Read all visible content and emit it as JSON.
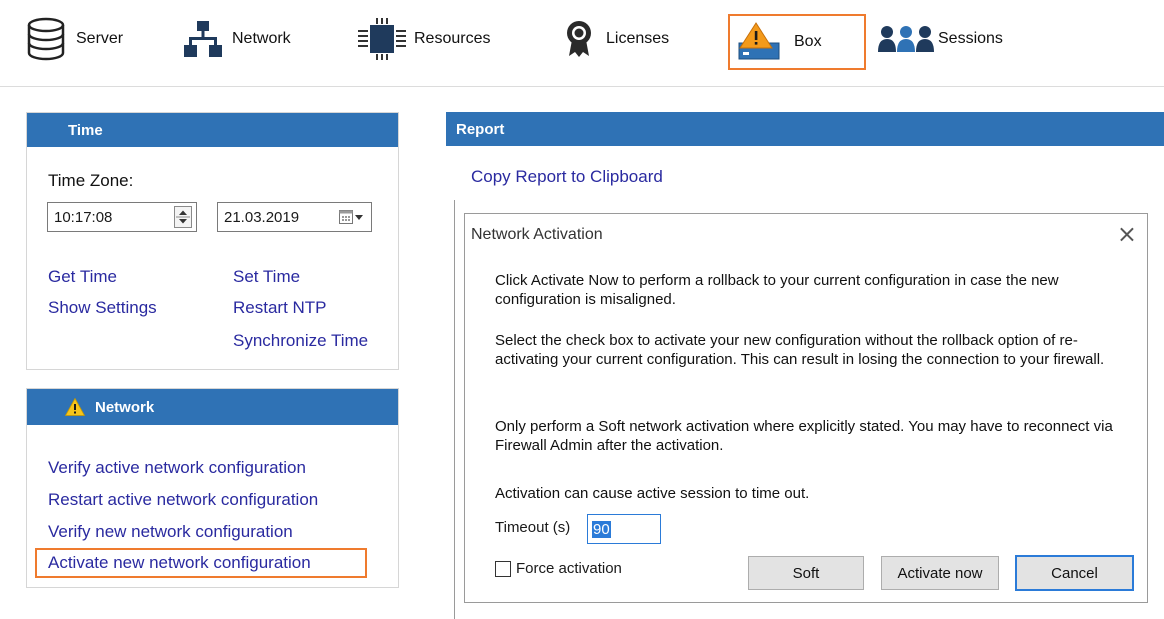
{
  "toolbar": {
    "items": [
      {
        "label": "Server",
        "icon": "database-icon"
      },
      {
        "label": "Network",
        "icon": "network-icon"
      },
      {
        "label": "Resources",
        "icon": "chip-icon"
      },
      {
        "label": "Licenses",
        "icon": "license-badge-icon"
      },
      {
        "label": "Box",
        "icon": "box-warning-icon"
      },
      {
        "label": "Sessions",
        "icon": "users-icon"
      }
    ],
    "active_item": "Box",
    "active_color": "#ef7b2e"
  },
  "time_panel": {
    "title": "Time",
    "timezone_label": "Time Zone:",
    "time_value": "10:17:08",
    "date_value": "21.03.2019",
    "links": {
      "get_time": "Get Time",
      "set_time": "Set Time",
      "show_settings": "Show Settings",
      "restart_ntp": "Restart NTP",
      "synchronize_time": "Synchronize Time"
    }
  },
  "network_panel": {
    "title": "Network",
    "links": [
      "Verify active network configuration",
      "Restart active network configuration",
      "Verify new network configuration",
      "Activate new network configuration"
    ],
    "highlight_color": "#ef7b2e"
  },
  "report_panel": {
    "title": "Report",
    "copy_link": "Copy Report to Clipboard"
  },
  "dialog": {
    "title": "Network Activation",
    "paragraph1": "Click Activate Now to perform a rollback to your current configuration in case the new configuration is misaligned.",
    "paragraph2": "Select the check box to activate your new configuration without the rollback option of re-activating your current configuration. This can result in losing the connection to your firewall.",
    "paragraph3": "Only perform a Soft network activation where explicitly stated. You may have to reconnect via Firewall Admin after the activation.",
    "paragraph4": "Activation can cause active session to time out.",
    "timeout_label": "Timeout (s)",
    "timeout_value": "90",
    "force_label": "Force activation",
    "buttons": {
      "soft": "Soft",
      "activate": "Activate now",
      "cancel": "Cancel"
    }
  },
  "colors": {
    "panel_header": "#2f72b5",
    "link": "#2a2aa0",
    "accent": "#ef7b2e",
    "default_button_border": "#2b7bd8"
  }
}
